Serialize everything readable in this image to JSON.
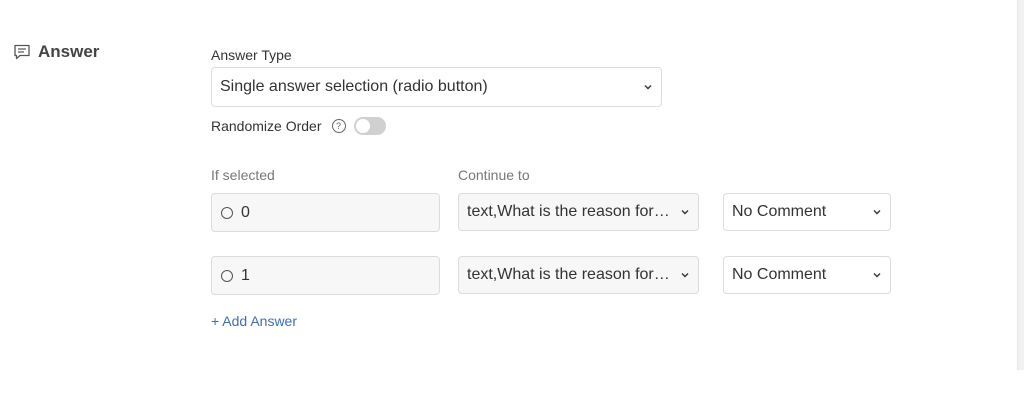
{
  "section": {
    "title": "Answer",
    "icon": "comment-icon"
  },
  "answer_type": {
    "label": "Answer Type",
    "selected": "Single answer selection (radio button)"
  },
  "randomize": {
    "label": "Randomize Order",
    "help_glyph": "?",
    "enabled": false
  },
  "columns": {
    "if_selected": "If selected",
    "continue_to": "Continue to"
  },
  "answers": [
    {
      "value": "0",
      "continue_to": "text,What is the reason for your rating?",
      "comment": "No Comment"
    },
    {
      "value": "1",
      "continue_to": "text,What is the reason for your rating?",
      "comment": "No Comment"
    }
  ],
  "add_answer_label": "+ Add Answer",
  "colors": {
    "link": "#3d6fb5",
    "toggle_off": "#d0d0d0",
    "input_bg": "#f7f7f7",
    "border": "#dcdcdc"
  }
}
